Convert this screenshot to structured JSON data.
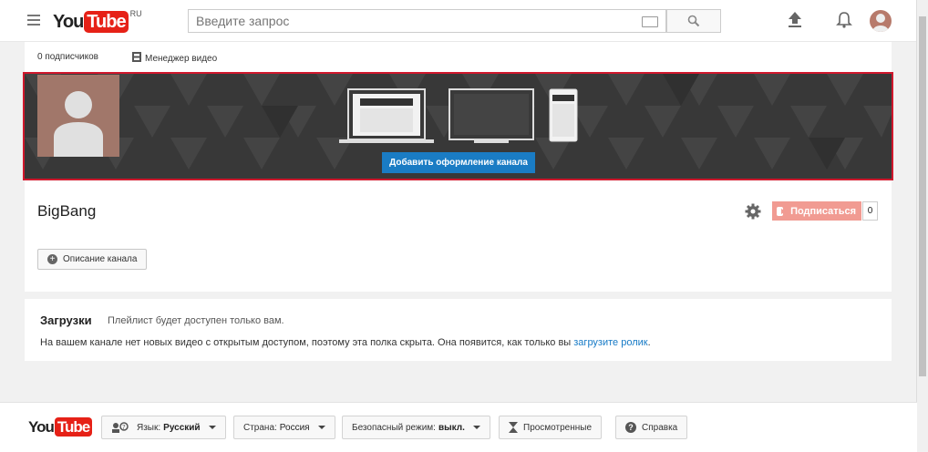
{
  "header": {
    "logo_you": "You",
    "logo_tube": "Tube",
    "logo_region": "RU",
    "search_placeholder": "Введите запрос",
    "menu_icon": "hamburger-icon",
    "icons": [
      "upload-icon",
      "bell-icon",
      "avatar"
    ]
  },
  "subbar": {
    "subscribers": "0 подписчиков",
    "video_manager": "Менеджер видео"
  },
  "banner": {
    "add_art_button": "Добавить оформление канала",
    "devices": [
      "laptop-icon",
      "tv-icon",
      "phone-icon"
    ],
    "highlight_color": "#d0182d"
  },
  "channel": {
    "name": "BigBang",
    "subscribe_label": "Подписаться",
    "subscriber_count": "0",
    "description_button": "Описание канала"
  },
  "uploads": {
    "title": "Загрузки",
    "note": "Плейлист будет доступен только вам.",
    "message": "На вашем канале нет новых видео с открытым доступом, поэтому эта полка скрыта. Она появится, как только вы",
    "link": "загрузите ролик",
    "message_end": "."
  },
  "footer": {
    "logo_you": "You",
    "logo_tube": "Tube",
    "language_label": "Язык:",
    "language_value": "Русский",
    "country_label": "Страна:",
    "country_value": "Россия",
    "safe_label": "Безопасный режим:",
    "safe_value": "выкл.",
    "history": "Просмотренные",
    "help": "Справка"
  },
  "annotation": {
    "arrow": "up-arrow-annotation"
  },
  "colors": {
    "accent_red": "#e62117",
    "button_blue": "#1a7cc4",
    "link_blue": "#167ac6"
  }
}
